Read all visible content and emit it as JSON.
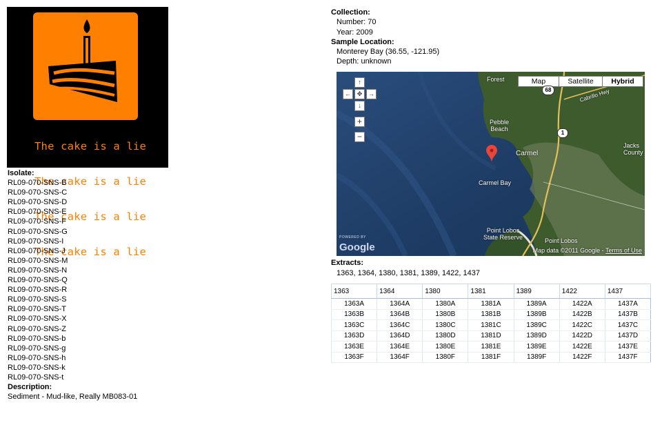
{
  "logo": {
    "caption_lines": [
      "The cake is a lie",
      "The cake is a lie",
      "The cake is a lie",
      "The cake is a lie"
    ]
  },
  "isolate": {
    "label": "Isolate:",
    "items": [
      "RL09-070-SNS-B",
      "RL09-070-SNS-C",
      "RL09-070-SNS-D",
      "RL09-070-SNS-E",
      "RL09-070-SNS-F",
      "RL09-070-SNS-G",
      "RL09-070-SNS-I",
      "RL09-070-SNS-J",
      "RL09-070-SNS-M",
      "RL09-070-SNS-N",
      "RL09-070-SNS-Q",
      "RL09-070-SNS-R",
      "RL09-070-SNS-S",
      "RL09-070-SNS-T",
      "RL09-070-SNS-X",
      "RL09-070-SNS-Z",
      "RL09-070-SNS-b",
      "RL09-070-SNS-g",
      "RL09-070-SNS-h",
      "RL09-070-SNS-k",
      "RL09-070-SNS-t"
    ]
  },
  "description": {
    "label": "Description:",
    "value": "Sediment - Mud-like, Really MB083-01"
  },
  "collection": {
    "label": "Collection:",
    "number": "Number: 70",
    "year": "Year: 2009"
  },
  "sample_location": {
    "label": "Sample Location:",
    "location": "Monterey Bay (36.55, -121.95)",
    "depth": "Depth: unknown"
  },
  "map": {
    "type_buttons": [
      "Map",
      "Satellite",
      "Hybrid"
    ],
    "active_type": "Hybrid",
    "places": {
      "forest": "Forest",
      "pebble_beach": "Pebble\nBeach",
      "carmel": "Carmel",
      "carmel_bay": "Carmel Bay",
      "point_lobos": "Point Lobos\nState Reserve",
      "jacks_county": "Jacks\nCounty",
      "point_lobos2": "Point Lobos"
    },
    "route_shields": [
      "1",
      "68"
    ],
    "road_label": "Cabrillo Hwy",
    "powered_by": "POWERED BY",
    "brand": "Google",
    "copyright_text": "Map data ©2011 Google - ",
    "terms_link": "Terms of Use",
    "colors": {
      "ocean": "#1f3f68",
      "land": "#3d5a2c",
      "pin": "#e8453c"
    }
  },
  "extracts": {
    "label": "Extracts:",
    "list": "1363, 1364, 1380, 1381, 1389, 1422, 1437",
    "headers": [
      "1363",
      "1364",
      "1380",
      "1381",
      "1389",
      "1422",
      "1437"
    ],
    "rows": [
      [
        "1363A",
        "1364A",
        "1380A",
        "1381A",
        "1389A",
        "1422A",
        "1437A"
      ],
      [
        "1363B",
        "1364B",
        "1380B",
        "1381B",
        "1389B",
        "1422B",
        "1437B"
      ],
      [
        "1363C",
        "1364C",
        "1380C",
        "1381C",
        "1389C",
        "1422C",
        "1437C"
      ],
      [
        "1363D",
        "1364D",
        "1380D",
        "1381D",
        "1389D",
        "1422D",
        "1437D"
      ],
      [
        "1363E",
        "1364E",
        "1380E",
        "1381E",
        "1389E",
        "1422E",
        "1437E"
      ],
      [
        "1363F",
        "1364F",
        "1380F",
        "1381F",
        "1389F",
        "1422F",
        "1437F"
      ]
    ]
  }
}
